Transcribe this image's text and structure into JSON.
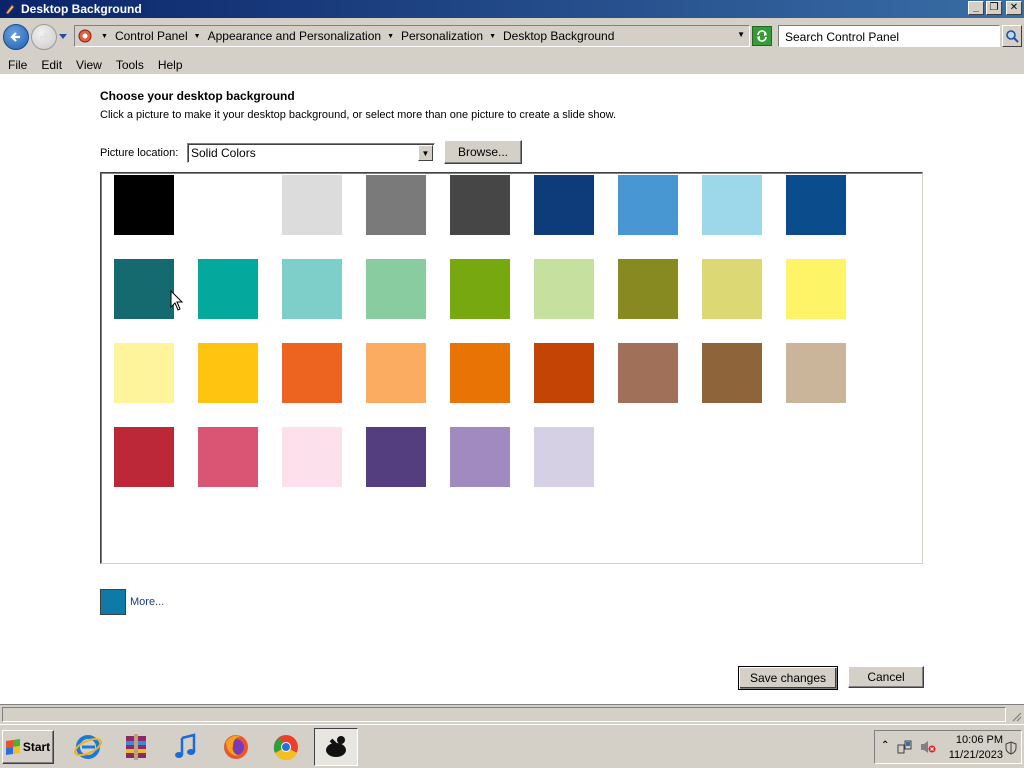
{
  "window": {
    "title": "Desktop Background"
  },
  "address": {
    "crumbs": [
      "Control Panel",
      "Appearance and Personalization",
      "Personalization",
      "Desktop Background"
    ],
    "search_placeholder": "Search Control Panel"
  },
  "menu": [
    "File",
    "Edit",
    "View",
    "Tools",
    "Help"
  ],
  "content": {
    "heading": "Choose your desktop background",
    "instructions": "Click a picture to make it your desktop background, or select more than one picture to create a slide show.",
    "location_label": "Picture location:",
    "location_value": "Solid Colors",
    "browse_label": "Browse...",
    "swatch_rows": [
      [
        "#000000",
        "#ffffff",
        "#dcdcdc",
        "#7a7a7a",
        "#464646",
        "#0e3c7a",
        "#4896d2",
        "#9cd8ea",
        "#0a4c8c"
      ],
      [
        "#146a6e",
        "#04a89c",
        "#7ecfca",
        "#88cca0",
        "#78a810",
        "#c6e0a0",
        "#868a20",
        "#dcd874",
        "#fef468"
      ],
      [
        "#fef49c",
        "#fec410",
        "#ec6420",
        "#fcac60",
        "#e87406",
        "#c44406",
        "#a07058",
        "#8e643a",
        "#cab49a"
      ],
      [
        "#bc2838",
        "#da5474",
        "#fce0ec",
        "#543e80",
        "#a08ac0",
        "#d6d0e4"
      ]
    ],
    "more_color": "#0e7aa8",
    "more_label": "More...",
    "save_label": "Save changes",
    "cancel_label": "Cancel"
  },
  "taskbar": {
    "start_label": "Start",
    "apps": [
      "internet-explorer-icon",
      "winrar-icon",
      "itunes-icon",
      "firefox-icon",
      "chrome-icon",
      "app-icon"
    ],
    "time": "10:06 PM",
    "date": "11/21/2023"
  }
}
